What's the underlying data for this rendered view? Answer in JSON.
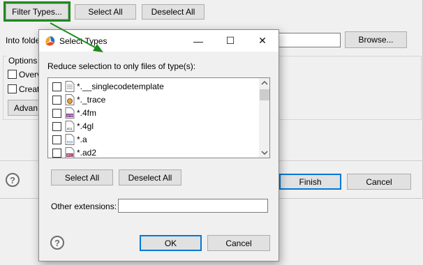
{
  "wizard": {
    "filter_types_label": "Filter Types...",
    "select_all_label": "Select All",
    "deselect_all_label": "Deselect All",
    "into_folder_label": "Into folde",
    "browse_label": "Browse...",
    "options_group_label": "Options",
    "overwrite_label": "Overv",
    "create_label": "Creat",
    "advanced_label": "Advan",
    "finish_label": "Finish",
    "cancel_label": "Cancel"
  },
  "dialog": {
    "title": "Select Types",
    "minimize_glyph": "—",
    "maximize_glyph": "☐",
    "close_glyph": "✕",
    "instruction": "Reduce selection to only files of type(s):",
    "file_types": [
      {
        "name": "*.__singlecodetemplate",
        "icon": "text-file-icon"
      },
      {
        "name": "*._trace",
        "icon": "trace-file-icon"
      },
      {
        "name": "*.4fm",
        "icon": "4fm-file-icon",
        "icon_text": "4FM"
      },
      {
        "name": "*.4gl",
        "icon": "4gl-file-icon",
        "icon_text": "4GL"
      },
      {
        "name": "*.a",
        "icon": "binary-file-icon",
        "icon_text": "010"
      },
      {
        "name": "*.ad2",
        "icon": "ad2-file-icon",
        "icon_text": "PRG"
      }
    ],
    "select_all_label": "Select All",
    "deselect_all_label": "Deselect All",
    "other_extensions_label": "Other extensions:",
    "other_extensions_value": "",
    "ok_label": "OK",
    "cancel_label": "Cancel",
    "help_glyph": "?"
  },
  "colors": {
    "annotation_arrow": "#1e8a1e",
    "primary_border": "#0078d7"
  }
}
